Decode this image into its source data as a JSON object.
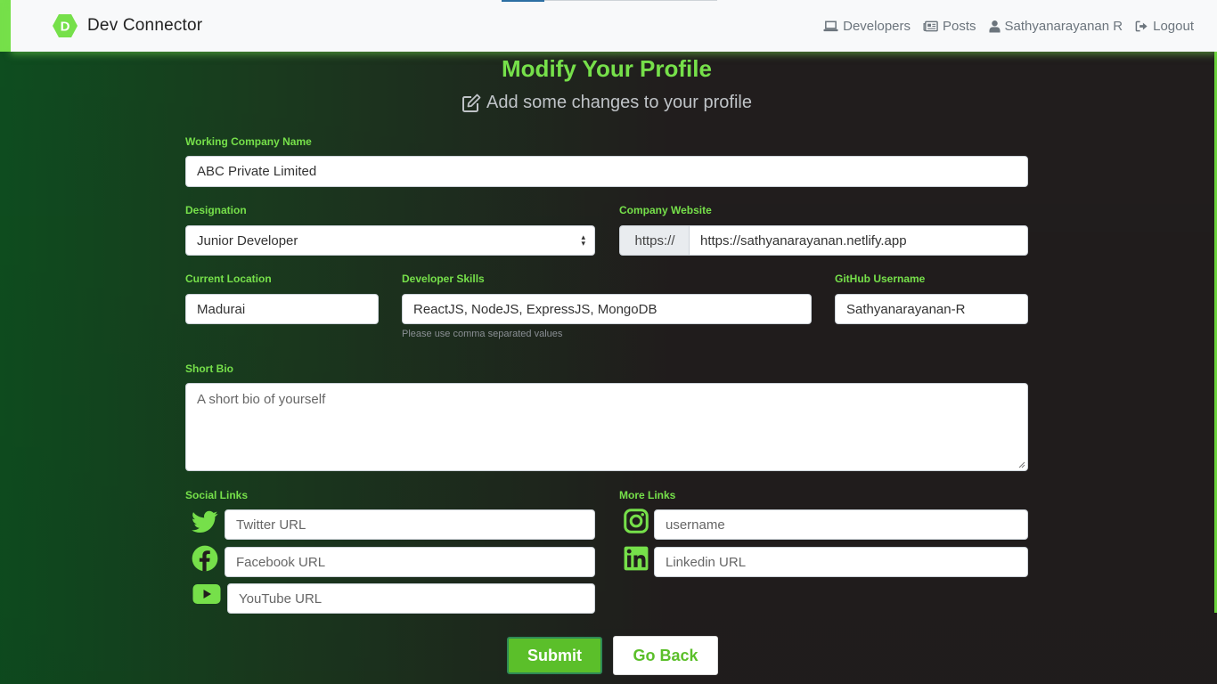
{
  "app": {
    "brand_initial": "D",
    "brand_name": "Dev Connector",
    "accent_color": "#76e04a"
  },
  "nav": {
    "developers": "Developers",
    "posts": "Posts",
    "user": "Sathyanarayanan R",
    "logout": "Logout"
  },
  "page": {
    "title": "Modify Your Profile",
    "subtitle": "Add some changes to your profile"
  },
  "form": {
    "company_label": "Working Company Name",
    "company_value": "ABC Private Limited",
    "designation_label": "Designation",
    "designation_value": "Junior Developer",
    "website_label": "Company Website",
    "website_prefix": "https://",
    "website_value": "https://sathyanarayanan.netlify.app",
    "location_label": "Current Location",
    "location_value": "Madurai",
    "skills_label": "Developer Skills",
    "skills_value": "ReactJS, NodeJS, ExpressJS, MongoDB",
    "skills_help": "Please use comma separated values",
    "github_label": "GitHub Username",
    "github_value": "Sathyanarayanan-R",
    "bio_label": "Short Bio",
    "bio_placeholder": "A short bio of yourself",
    "social_label": "Social Links",
    "more_label": "More Links",
    "twitter_placeholder": "Twitter URL",
    "facebook_placeholder": "Facebook URL",
    "youtube_placeholder": "YouTube URL",
    "instagram_placeholder": "username",
    "linkedin_placeholder": "Linkedin URL",
    "submit_label": "Submit",
    "back_label": "Go Back"
  },
  "icons": {
    "brand": "hexagon-logo-icon",
    "developers": "laptop-icon",
    "posts": "newspaper-icon",
    "user": "user-icon",
    "logout": "sign-out-icon",
    "subtitle": "edit-icon",
    "twitter": "twitter-icon",
    "facebook": "facebook-icon",
    "youtube": "youtube-icon",
    "instagram": "instagram-icon",
    "linkedin": "linkedin-icon"
  }
}
